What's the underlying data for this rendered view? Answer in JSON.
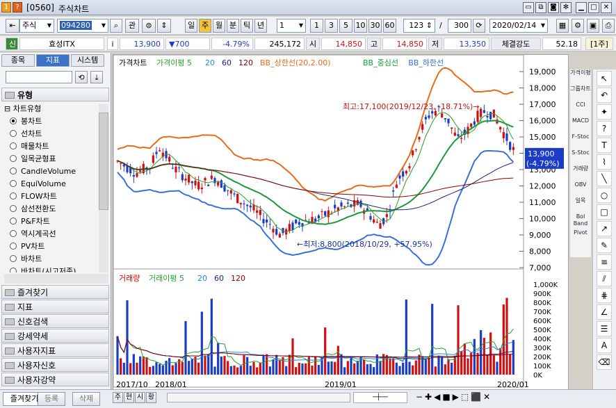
{
  "window": {
    "code": "[0560]",
    "title": "주식차트",
    "help": "?",
    "num": "1"
  },
  "toolbar": {
    "market": "주식",
    "code": "094280",
    "gwan": "관",
    "periods": [
      "일",
      "주",
      "월",
      "분",
      "틱",
      "년"
    ],
    "active_period": "주",
    "unit": "1",
    "nums": [
      "1",
      "3",
      "5",
      "10",
      "30",
      "60"
    ],
    "count": "123",
    "slash": "/",
    "total": "300",
    "date": "2020/02/14"
  },
  "quote": {
    "tag": "신",
    "name": "효성ITX",
    "info": "i",
    "price": "13,900",
    "change": "▼700",
    "rate": "-4.79%",
    "volume": "245,172",
    "open_label": "시",
    "open": "14,850",
    "high_label": "고",
    "high": "14,850",
    "low_label": "저",
    "low": "13,350",
    "strength_label": "체결강도",
    "strength": "52.18",
    "week": "[1주]"
  },
  "left": {
    "tabs": [
      "종목",
      "지표",
      "시스템"
    ],
    "active_tab": "지표",
    "section": "유형",
    "group": "차트유형",
    "items": [
      "봉차트",
      "선차트",
      "매물차트",
      "일목균형표",
      "CandleVolume",
      "EquiVolume",
      "FLOW차트",
      "삼선전환도",
      "P&F차트",
      "역시계곡선",
      "PV차트",
      "바차트",
      "바차트(시고저종)"
    ],
    "selected": "봉차트",
    "sections": [
      "즐겨찾기",
      "지표",
      "신호검색",
      "강세약세",
      "사용자지표",
      "사용자신호",
      "사용자강약"
    ],
    "bottom_tabs": [
      "즐겨찾기",
      "등록",
      "삭제"
    ]
  },
  "chart": {
    "legend_price": [
      "가격차트",
      "가격이평 5",
      "20",
      "60",
      "120",
      "BB_상한선(20,2.00)",
      "BB_중심선",
      "BB_하한선"
    ],
    "legend_price_colors": [
      "#000",
      "#2a9d2a",
      "#1e88e5",
      "#1a237e",
      "#8b0000",
      "#e86a1a",
      "#1a9a3a",
      "#3a6fd8"
    ],
    "legend_vol": [
      "거래량",
      "거래이평 5",
      "20",
      "60",
      "120"
    ],
    "legend_vol_colors": [
      "#c00",
      "#2a9d2a",
      "#1e88e5",
      "#1a237e",
      "#8b0000"
    ],
    "price_ticks": [
      "19,000",
      "18,000",
      "17,000",
      "16,000",
      "15,000",
      "14,000",
      "13,000",
      "12,000",
      "11,000",
      "10,000",
      "9,000",
      "8,000",
      "7,000"
    ],
    "vol_ticks": [
      "1,000K",
      "900K",
      "800K",
      "700K",
      "600K",
      "500K",
      "400K",
      "300K",
      "200K",
      "100K",
      "0K"
    ],
    "x_ticks": [
      "2017/10",
      "2018/01",
      "2019/01",
      "2020/01"
    ],
    "high_note": "최고:17,100(2019/12/23, -18.71%)→",
    "low_note": "←최저:8,800(2018/10/29, +57.95%)",
    "last_price": "13,900",
    "last_rate": "(-4.79%)"
  },
  "chart_bottom": [
    "주",
    "현",
    "시",
    "황"
  ],
  "right_tools": [
    "가격이평",
    "그룹차트",
    "CCI",
    "MACD",
    "F-Stoc",
    "S-Stoc",
    "거래량",
    "OBV",
    "일목",
    "Bol Band",
    "Pivot"
  ],
  "chart_data": {
    "type": "candlestick",
    "title": "",
    "x_ticks": [
      "2017/10",
      "2018/01",
      "2019/01",
      "2020/01"
    ],
    "ylim": [
      7000,
      19000
    ],
    "high": {
      "value": 17100,
      "date": "2019/12/23"
    },
    "low": {
      "value": 8800,
      "date": "2018/10/29"
    },
    "last": 13900,
    "volume_ylim": [
      0,
      1000000
    ]
  }
}
